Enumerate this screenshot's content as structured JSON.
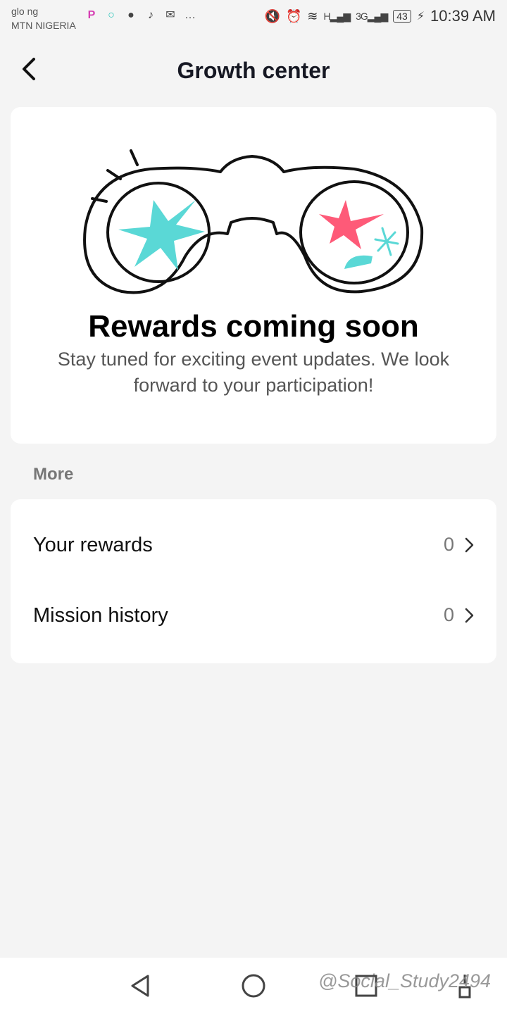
{
  "status_bar": {
    "carrier_line1": "glo ng",
    "carrier_line2": "MTN NIGERIA",
    "notification_icons": [
      "picsart-icon",
      "circle-app-icon",
      "snapchat-icon",
      "tiktok-icon",
      "mail-icon",
      "more-icon"
    ],
    "network_h": "H",
    "network_3g": "3G",
    "battery": "43",
    "time": "10:39 AM"
  },
  "header": {
    "title": "Growth center"
  },
  "hero": {
    "title": "Rewards coming soon",
    "subtitle": "Stay tuned for exciting event updates. We look forward to your participation!",
    "colors": {
      "teal": "#5ad8d6",
      "pink": "#fe5a78"
    }
  },
  "more_section": {
    "label": "More",
    "items": [
      {
        "label": "Your rewards",
        "count": "0"
      },
      {
        "label": "Mission history",
        "count": "0"
      }
    ]
  },
  "watermark": "@Social_Study2494"
}
